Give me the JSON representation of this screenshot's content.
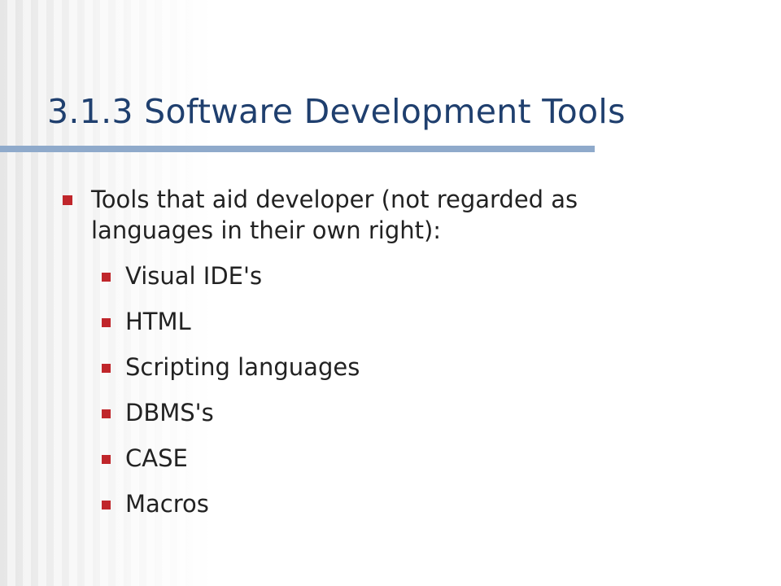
{
  "slide": {
    "title": "3.1.3 Software Development Tools",
    "main_bullet": {
      "line1": "Tools that aid developer (not regarded as",
      "line2": "languages in their own right):"
    },
    "sub_items": [
      "Visual IDE's",
      "HTML",
      "Scripting languages",
      "DBMS's",
      "CASE",
      "Macros"
    ]
  },
  "colors": {
    "title": "#1f3f6e",
    "rule": "#8faacb",
    "bullet": "#c0262b",
    "body_text": "#222222"
  }
}
